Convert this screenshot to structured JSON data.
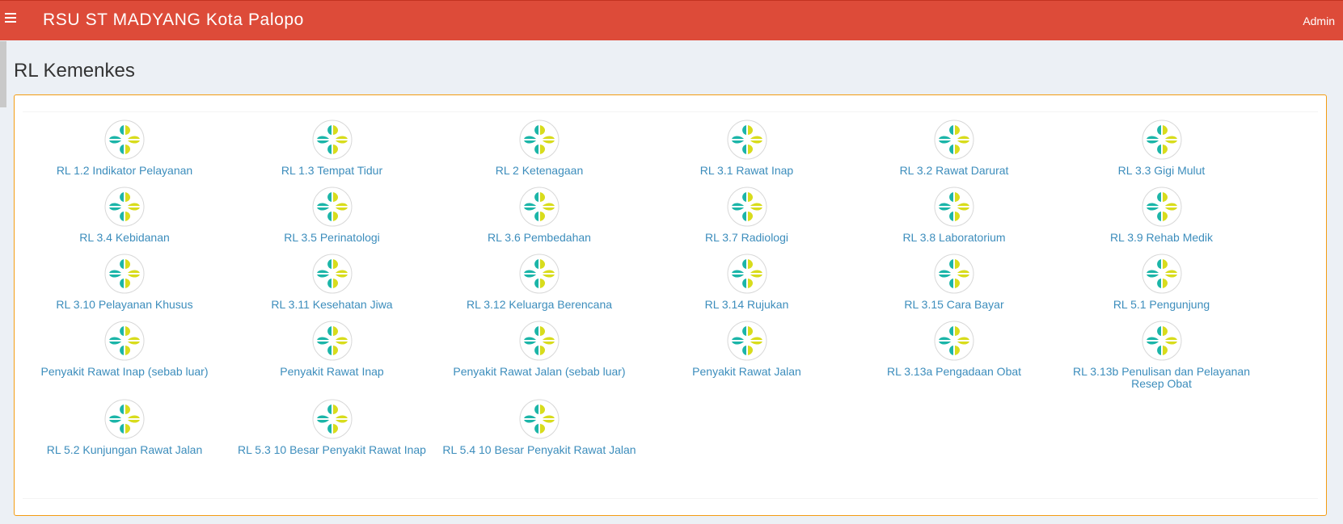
{
  "header": {
    "app_title": "RSU ST MADYANG Kota Palopo",
    "user": "Admin"
  },
  "page": {
    "title": "RL Kemenkes"
  },
  "tiles": [
    "RL 1.2 Indikator Pelayanan",
    "RL 1.3 Tempat Tidur",
    "RL 2 Ketenagaan",
    "RL 3.1 Rawat Inap",
    "RL 3.2 Rawat Darurat",
    "RL 3.3 Gigi Mulut",
    "RL 3.4 Kebidanan",
    "RL 3.5 Perinatologi",
    "RL 3.6 Pembedahan",
    "RL 3.7 Radiologi",
    "RL 3.8 Laboratorium",
    "RL 3.9 Rehab Medik",
    "RL 3.10 Pelayanan Khusus",
    "RL 3.11 Kesehatan Jiwa",
    "RL 3.12 Keluarga Berencana",
    "RL 3.14 Rujukan",
    "RL 3.15 Cara Bayar",
    "RL 5.1 Pengunjung",
    "Penyakit Rawat Inap (sebab luar)",
    "Penyakit Rawat Inap",
    "Penyakit Rawat Jalan (sebab luar)",
    "Penyakit Rawat Jalan",
    "RL 3.13a Pengadaan Obat",
    "RL 3.13b Penulisan dan Pelayanan Resep Obat",
    "RL 5.2 Kunjungan Rawat Jalan",
    "RL 5.3 10 Besar Penyakit Rawat Inap",
    "RL 5.4 10 Besar Penyakit Rawat Jalan"
  ],
  "icon": {
    "name": "kemenkes-logo-icon",
    "color_teal": "#1bb5a8",
    "color_yellow": "#d8dc1c"
  },
  "colors": {
    "header_bg": "#dd4b39",
    "link": "#3c8dbc",
    "box_border": "#f39c12"
  }
}
